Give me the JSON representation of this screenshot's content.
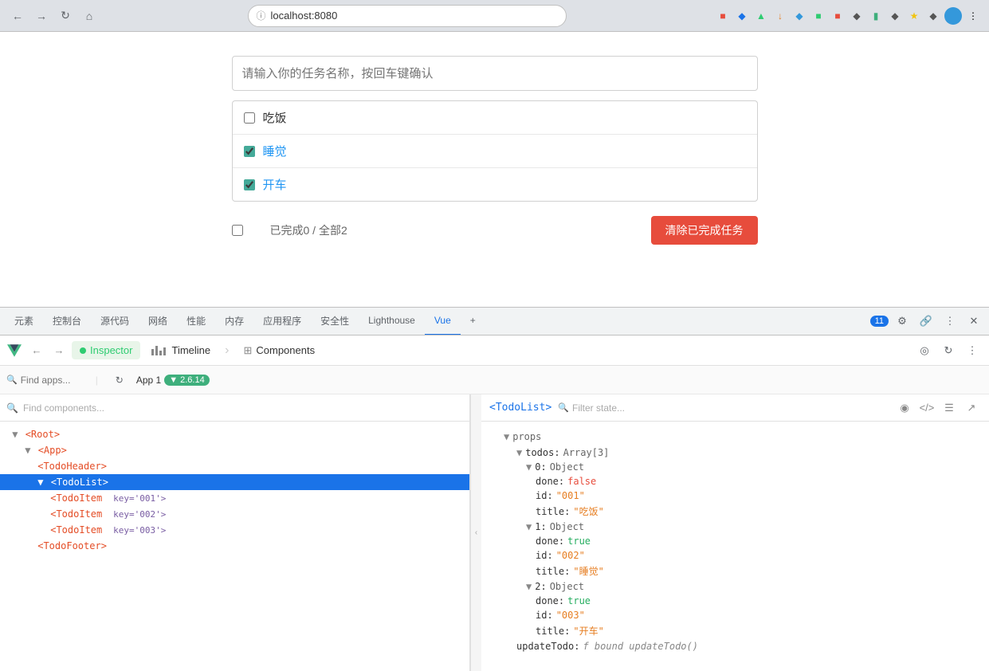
{
  "browser": {
    "url": "localhost:8080",
    "back_title": "Back",
    "forward_title": "Forward",
    "reload_title": "Reload",
    "home_title": "Home"
  },
  "todo": {
    "input_placeholder": "请输入你的任务名称，按回车键确认",
    "items": [
      {
        "id": "001",
        "text": "吃饭",
        "done": false
      },
      {
        "id": "002",
        "text": "睡觉",
        "done": true
      },
      {
        "id": "003",
        "text": "开车",
        "done": true
      }
    ],
    "footer_text": "已完成0 / 全部2",
    "clear_btn": "清除已完成任务"
  },
  "devtools": {
    "tabs": [
      "元素",
      "控制台",
      "源代码",
      "网络",
      "性能",
      "内存",
      "应用程序",
      "安全性",
      "Lighthouse",
      "Vue"
    ],
    "active_tab": "Vue",
    "badge_count": "11"
  },
  "vue_devtools": {
    "logo": "▶",
    "inspector_label": "Inspector",
    "timeline_label": "Timeline",
    "components_label": "Components",
    "app_label": "App 1",
    "app_version": "▼ 2.6.14",
    "find_apps_placeholder": "Find apps...",
    "find_components_placeholder": "Find components...",
    "component_name": "<TodoList>",
    "filter_state_placeholder": "Filter state...",
    "tree": {
      "root": "<Root>",
      "app": "<App>",
      "todo_header": "<TodoHeader>",
      "todo_list": "<TodoList>",
      "todo_item1": "<TodoItem",
      "todo_item1_attr": "key='001'>",
      "todo_item2": "<TodoItem",
      "todo_item2_attr": "key='002'>",
      "todo_item3": "<TodoItem",
      "todo_item3_attr": "key='003'>",
      "todo_footer": "<TodoFooter>"
    },
    "props": {
      "section_label": "▼ props",
      "todos_label": "todos: Array[3]",
      "item0_label": "▼ 0: Object",
      "item0_done_key": "done:",
      "item0_done_val": "false",
      "item0_id_key": "id:",
      "item0_id_val": "\"001\"",
      "item0_title_key": "title:",
      "item0_title_val": "\"吃饭\"",
      "item1_label": "▼ 1: Object",
      "item1_done_key": "done:",
      "item1_done_val": "true",
      "item1_id_key": "id:",
      "item1_id_val": "\"002\"",
      "item1_title_key": "title:",
      "item1_title_val": "\"睡觉\"",
      "item2_label": "▼ 2: Object",
      "item2_done_key": "done:",
      "item2_done_val": "true",
      "item2_id_key": "id:",
      "item2_id_val": "\"003\"",
      "item2_title_key": "title:",
      "item2_title_val": "\"开车\"",
      "update_todo_key": "updateTodo:",
      "update_todo_val": "f bound updateTodo()"
    }
  }
}
